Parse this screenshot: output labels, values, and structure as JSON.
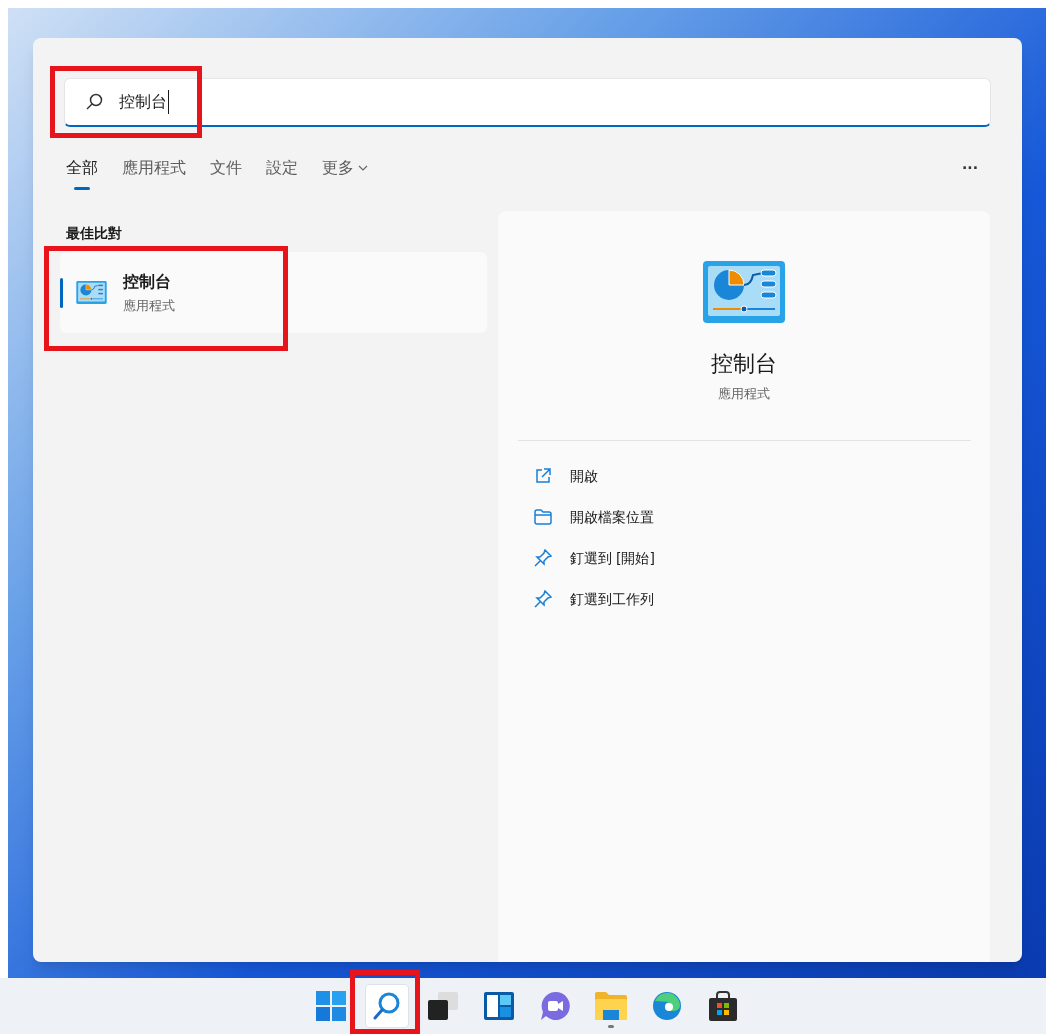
{
  "search": {
    "value": "控制台"
  },
  "tabs": [
    {
      "label": "全部",
      "selected": true
    },
    {
      "label": "應用程式",
      "selected": false
    },
    {
      "label": "文件",
      "selected": false
    },
    {
      "label": "設定",
      "selected": false
    },
    {
      "label": "更多",
      "selected": false,
      "dropdown": true
    }
  ],
  "more_options": "···",
  "best_match": {
    "heading": "最佳比對",
    "items": [
      {
        "title": "控制台",
        "subtitle": "應用程式",
        "selected": true
      }
    ]
  },
  "details": {
    "title": "控制台",
    "subtitle": "應用程式",
    "actions": [
      {
        "kind": "open",
        "label": "開啟"
      },
      {
        "kind": "folder",
        "label": "開啟檔案位置"
      },
      {
        "kind": "pin",
        "label": "釘選到 [開始]"
      },
      {
        "kind": "pin",
        "label": "釘選到工作列"
      }
    ]
  },
  "taskbar": [
    {
      "kind": "start",
      "selected": false,
      "running": false
    },
    {
      "kind": "search",
      "selected": true,
      "running": false
    },
    {
      "kind": "taskview",
      "selected": false,
      "running": false
    },
    {
      "kind": "widgets",
      "selected": false,
      "running": false
    },
    {
      "kind": "chat",
      "selected": false,
      "running": false
    },
    {
      "kind": "explorer",
      "selected": false,
      "running": true
    },
    {
      "kind": "browser",
      "selected": false,
      "running": false
    },
    {
      "kind": "store",
      "selected": false,
      "running": false
    }
  ]
}
